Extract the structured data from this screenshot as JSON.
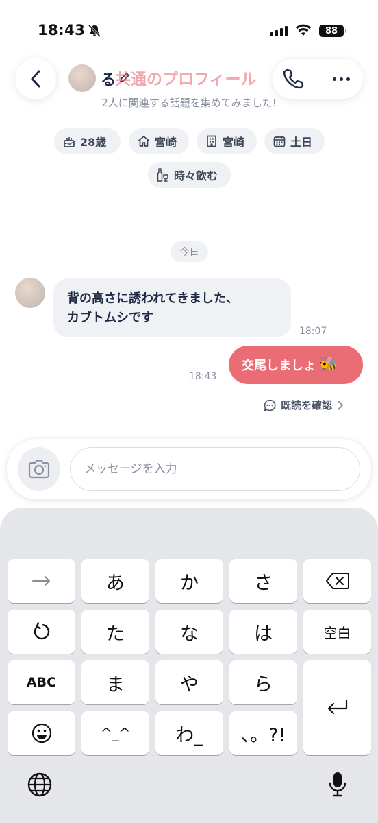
{
  "status_bar": {
    "time": "18:43",
    "battery": "88"
  },
  "header": {
    "name": "る",
    "common_title": "共通のプロフィール",
    "subtitle": "2人に関連する話題を集めてみました!"
  },
  "profile_tags": [
    {
      "icon": "birthday-cake-icon",
      "label": "28歳"
    },
    {
      "icon": "home-icon",
      "label": "宮崎"
    },
    {
      "icon": "building-icon",
      "label": "宮崎"
    },
    {
      "icon": "calendar-icon",
      "label": "土日"
    },
    {
      "icon": "drinks-icon",
      "label": "時々飲む"
    }
  ],
  "chat": {
    "date_label": "今日",
    "messages": [
      {
        "direction": "incoming",
        "lines": [
          "背の高さに誘われてきました、",
          "カブトムシです"
        ],
        "time": "18:07"
      },
      {
        "direction": "outgoing",
        "text": "交尾しましょ",
        "emoji": "🐝",
        "time": "18:43"
      }
    ],
    "read_receipt": "既読を確認"
  },
  "composer": {
    "placeholder": "メッセージを入力",
    "value": ""
  },
  "keyboard": {
    "rows": [
      [
        "→",
        "あ",
        "か",
        "さ",
        "⌫"
      ],
      [
        "↺",
        "た",
        "な",
        "は",
        "空白"
      ],
      [
        "ABC",
        "ま",
        "や",
        "ら"
      ],
      [
        "☺",
        "^_^",
        "わ_",
        "、。?!"
      ]
    ]
  },
  "colors": {
    "accent": "#ea6d75",
    "bubble_in": "#f0f1f4",
    "text": "#1f2a44",
    "muted": "#8a90a0"
  }
}
